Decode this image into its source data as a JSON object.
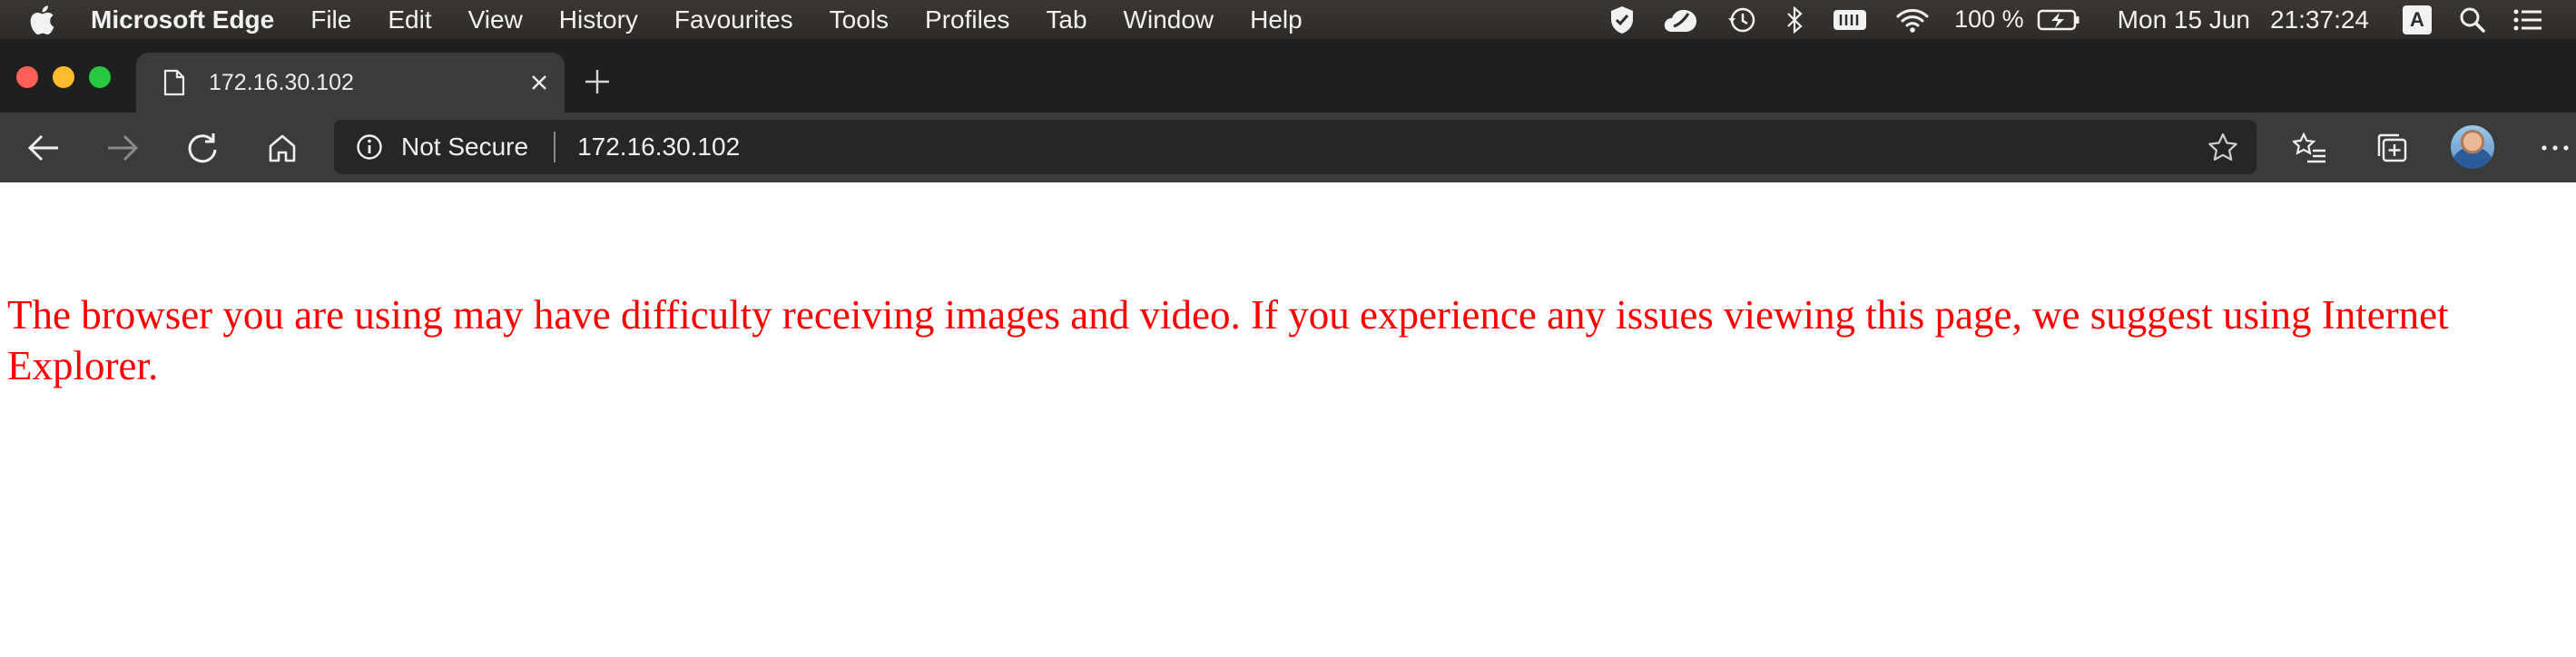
{
  "menubar": {
    "app_name": "Microsoft Edge",
    "items": [
      "File",
      "Edit",
      "View",
      "History",
      "Favourites",
      "Tools",
      "Profiles",
      "Tab",
      "Window",
      "Help"
    ],
    "battery": "100 %",
    "date": "Mon 15 Jun",
    "time": "21:37:24",
    "input_source": "A",
    "tray_icons": [
      "shield-check-icon",
      "cloud-sync-icon",
      "time-machine-icon",
      "bluetooth-icon",
      "battery-strip-icon",
      "wifi-icon",
      "battery-charging-icon",
      "search-icon",
      "control-center-icon"
    ]
  },
  "tab": {
    "title": "172.16.30.102",
    "icon": "page-icon"
  },
  "toolbar": {
    "security_label": "Not Secure",
    "url": "172.16.30.102",
    "icons": [
      "back-icon",
      "forward-icon",
      "refresh-icon",
      "home-icon",
      "info-icon",
      "star-icon",
      "favorites-icon",
      "collections-icon",
      "avatar",
      "more-icon"
    ]
  },
  "page": {
    "warning_text": "The browser you are using may have difficulty receiving images and video. If you experience any issues viewing this page, we suggest using Internet Explorer."
  },
  "colors": {
    "warning": "#ff0000",
    "menubar_bg": "#2e2b28",
    "tabstrip_bg": "#1f1f1f",
    "toolbar_bg": "#3b3b3b",
    "omnibox_bg": "#262626"
  }
}
